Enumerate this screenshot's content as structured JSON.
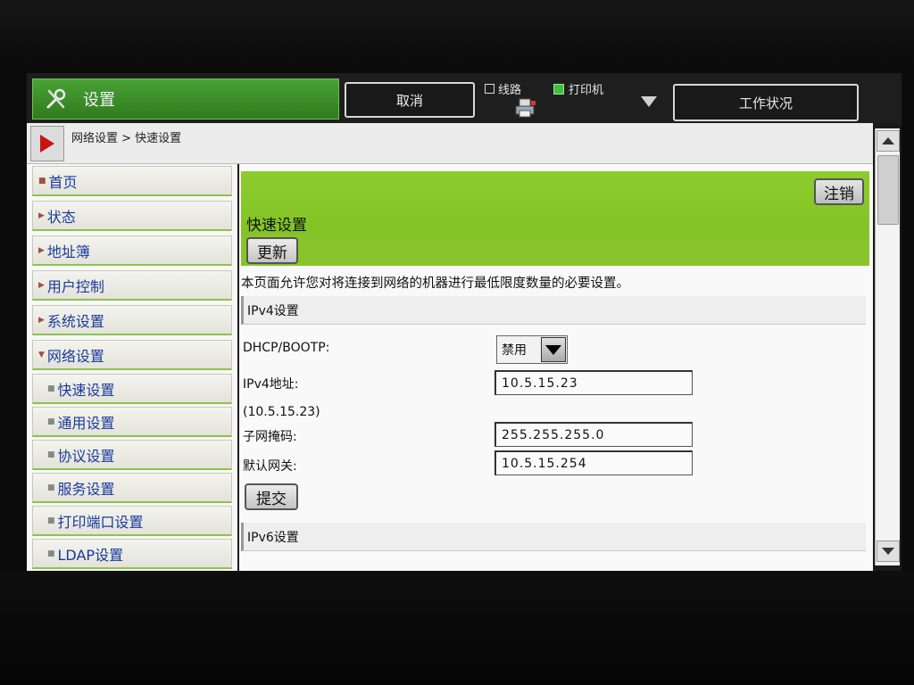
{
  "topbar": {
    "mode_tab_label": "设置",
    "cancel_label": "取消",
    "line_label": "线路",
    "printer_label": "打印机",
    "job_status_label": "工作状况"
  },
  "breadcrumb": "网络设置 > 快速设置",
  "sidebar": {
    "items": [
      {
        "label": "首页"
      },
      {
        "label": "状态"
      },
      {
        "label": "地址簿"
      },
      {
        "label": "用户控制"
      },
      {
        "label": "系统设置"
      },
      {
        "label": "网络设置"
      },
      {
        "label": "快速设置"
      },
      {
        "label": "通用设置"
      },
      {
        "label": "协议设置"
      },
      {
        "label": "服务设置"
      },
      {
        "label": "打印端口设置"
      },
      {
        "label": "LDAP设置"
      }
    ]
  },
  "main": {
    "logout_label": "注销",
    "title": "快速设置",
    "refresh_label": "更新",
    "description": "本页面允许您对将连接到网络的机器进行最低限度数量的必要设置。",
    "ipv4_section": "IPv4设置",
    "dhcp_label": "DHCP/BOOTP:",
    "dhcp_value": "禁用",
    "ipv4_address_label": "IPv4地址:",
    "ipv4_address_value": "10.5.15.23",
    "ipv4_current": "(10.5.15.23)",
    "subnet_label": "子网掩码:",
    "subnet_value": "255.255.255.0",
    "gateway_label": "默认网关:",
    "gateway_value": "10.5.15.254",
    "submit_label": "提交",
    "ipv6_section": "IPv6设置"
  },
  "colors": {
    "accent_green": "#86c42a",
    "mode_tab_green": "#3a8f28",
    "nav_text_blue": "#1a3a9a",
    "play_red": "#cc1111"
  }
}
